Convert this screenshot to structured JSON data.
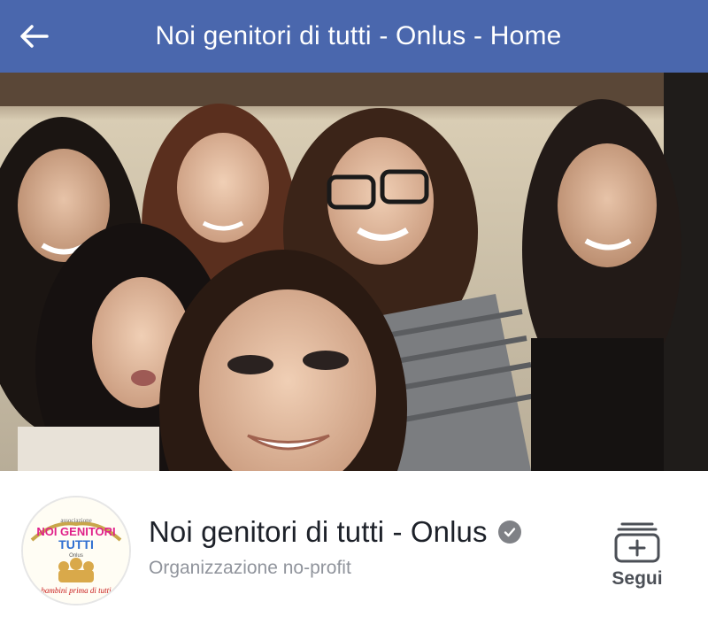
{
  "header": {
    "title": "Noi genitori di tutti - Onlus - Home",
    "back_icon": "arrow-left-icon",
    "background": "#4a67ad"
  },
  "cover": {
    "description_icon": "cover-photo"
  },
  "page": {
    "name": "Noi genitori di tutti - Onlus",
    "category": "Organizzazione no-profit",
    "verified_icon": "verified-badge-icon",
    "logo": {
      "line1": "associazione",
      "line2": "NOI GENITORI",
      "line3": "TUTTI",
      "line4": "Onlus",
      "tagline": "bambini prima di tutti"
    }
  },
  "actions": {
    "follow_label": "Segui",
    "follow_icon": "follow-plus-icon"
  }
}
